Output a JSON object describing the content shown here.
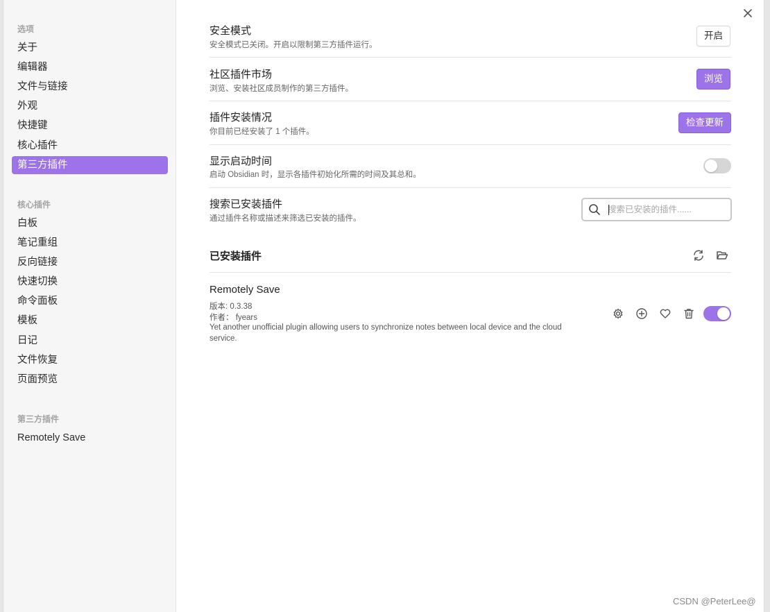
{
  "sidebar": {
    "options_heading": "选项",
    "options": [
      "关于",
      "编辑器",
      "文件与链接",
      "外观",
      "快捷键",
      "核心插件",
      "第三方插件"
    ],
    "active_option": "第三方插件",
    "core_heading": "核心插件",
    "core_plugins": [
      "白板",
      "笔记重组",
      "反向链接",
      "快速切换",
      "命令面板",
      "模板",
      "日记",
      "文件恢复",
      "页面预览"
    ],
    "community_heading": "第三方插件",
    "community_plugins": [
      "Remotely Save"
    ]
  },
  "settings": {
    "safe_mode": {
      "name": "安全模式",
      "desc": "安全模式已关闭。开启以限制第三方插件运行。",
      "button": "开启"
    },
    "market": {
      "name": "社区插件市场",
      "desc": "浏览、安装社区成员制作的第三方插件。",
      "button": "浏览"
    },
    "installed": {
      "name": "插件安装情况",
      "desc": "你目前已经安装了 1 个插件。",
      "button": "检查更新"
    },
    "startup_time": {
      "name": "显示启动时间",
      "desc": "启动 Obsidian 时，显示各插件初始化所需的时间及其总和。",
      "enabled": false
    },
    "search": {
      "name": "搜索已安装插件",
      "desc": "通过插件名称或描述来筛选已安装的插件。",
      "placeholder": "搜索已安装的插件......"
    }
  },
  "installed_section": {
    "title": "已安装插件",
    "plugins": [
      {
        "name": "Remotely Save",
        "version": "版本: 0.3.38",
        "author": "作者： fyears",
        "description": "Yet another unofficial plugin allowing users to synchronize notes between local device and the cloud service.",
        "enabled": true
      }
    ]
  },
  "colors": {
    "accent": "#9d73ea",
    "sidebar_bg": "#f6f6f6"
  },
  "icons": [
    "close-icon",
    "search-icon",
    "reload-icon",
    "folder-open-icon",
    "gear-icon",
    "plus-circle-icon",
    "heart-icon",
    "trash-icon"
  ],
  "watermark": "CSDN @PeterLee@"
}
